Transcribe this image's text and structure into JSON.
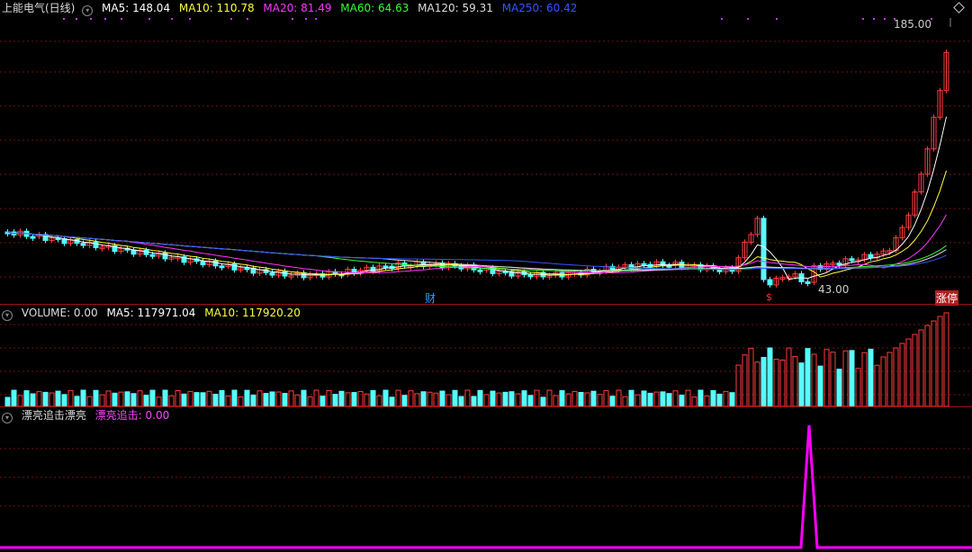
{
  "price_header": {
    "title": "上能电气(日线)",
    "ma": [
      {
        "label": "MA5: 148.04",
        "color": "#ffffff"
      },
      {
        "label": "MA10: 110.78",
        "color": "#ffff33"
      },
      {
        "label": "MA20: 81.49",
        "color": "#ff33ff"
      },
      {
        "label": "MA60: 64.63",
        "color": "#33ff33"
      },
      {
        "label": "MA120: 59.31",
        "color": "#dddddd"
      },
      {
        "label": "MA250: 60.42",
        "color": "#3355ff"
      }
    ]
  },
  "price_labels": {
    "high": "185.00",
    "low": "43.00"
  },
  "event_markers": [
    {
      "text": "财",
      "color": "#3399ff"
    },
    {
      "text": "$",
      "color": "#ff3333"
    },
    {
      "text": "涨停",
      "color": "#ffffff"
    }
  ],
  "volume_header": {
    "title": "VOLUME: 0.00",
    "ma5": "MA5: 117971.04",
    "ma10": "MA10: 117920.20"
  },
  "indicator_header": {
    "title": "漂亮追击漂亮",
    "value": "漂亮追击: 0.00"
  },
  "colors": {
    "up": "#ff3c3c",
    "down": "#54ffff",
    "grid": "#7a1010",
    "signal": "#ff00ff"
  }
}
